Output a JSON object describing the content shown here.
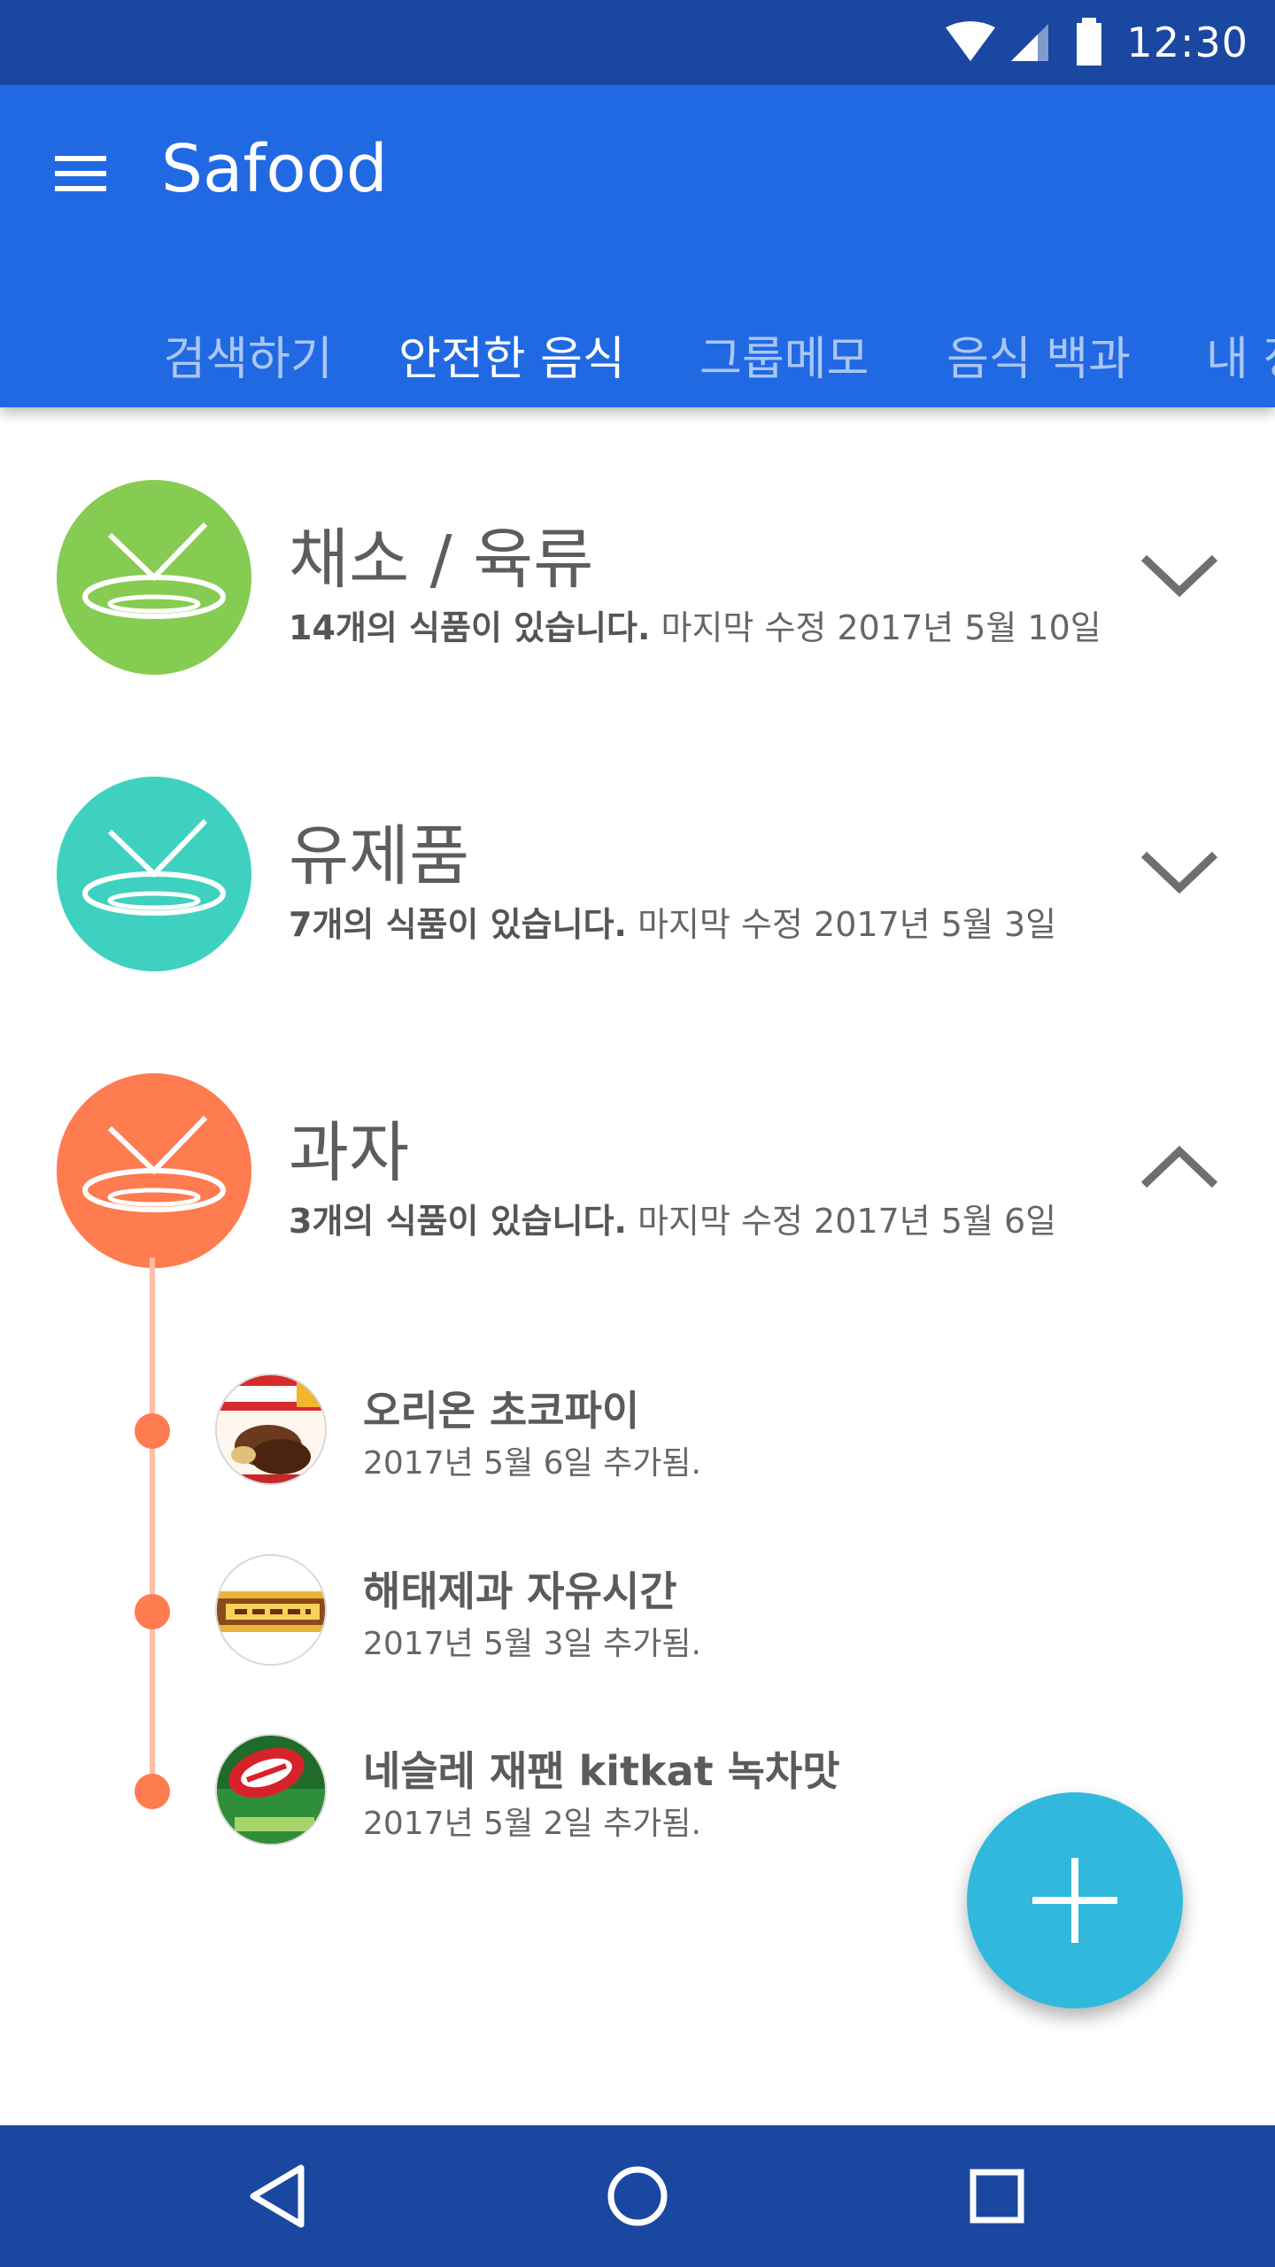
{
  "status_bar": {
    "time": "12:30",
    "icons": [
      "wifi-icon",
      "cell-signal-icon",
      "battery-icon"
    ]
  },
  "app_bar": {
    "title": "Safood",
    "menu_icon": "menu-icon",
    "tabs": [
      {
        "label": "검색하기",
        "active": false
      },
      {
        "label": "안전한 음식",
        "active": true
      },
      {
        "label": "그룹메모",
        "active": false
      },
      {
        "label": "음식 백과",
        "active": false
      },
      {
        "label": "내 정",
        "active": false
      }
    ]
  },
  "categories": [
    {
      "title": "채소 / 육류",
      "count_text": "14개의 식품이 있습니다.",
      "modified_text": "마지막 수정 2017년 5월 10일",
      "color": "#86cc52",
      "expanded": false
    },
    {
      "title": "유제품",
      "count_text": "7개의 식품이 있습니다.",
      "modified_text": "마지막 수정 2017년 5월 3일",
      "color": "#3fd1bf",
      "expanded": false
    },
    {
      "title": "과자",
      "count_text": "3개의 식품이 있습니다.",
      "modified_text": "마지막 수정 2017년 5월 6일",
      "color": "#ff7b50",
      "expanded": true
    }
  ],
  "food_items": [
    {
      "name": "오리온 초코파이",
      "added": "2017년 5월 6일 추가됨.",
      "thumb": "chocopie-thumbnail"
    },
    {
      "name": "해태제과 자유시간",
      "added": "2017년 5월 3일 추가됨.",
      "thumb": "jayusigan-thumbnail"
    },
    {
      "name": "네슬레 재팬 kitkat 녹차맛",
      "added": "2017년 5월 2일 추가됨.",
      "thumb": "kitkat-thumbnail"
    }
  ],
  "fab": {
    "icon": "plus-icon",
    "color": "#30b9dd"
  },
  "colors": {
    "status_bar": "#1a47a0",
    "app_bar": "#2169e3",
    "timeline": "#ffbda3",
    "timeline_dot": "#ff7b50"
  }
}
